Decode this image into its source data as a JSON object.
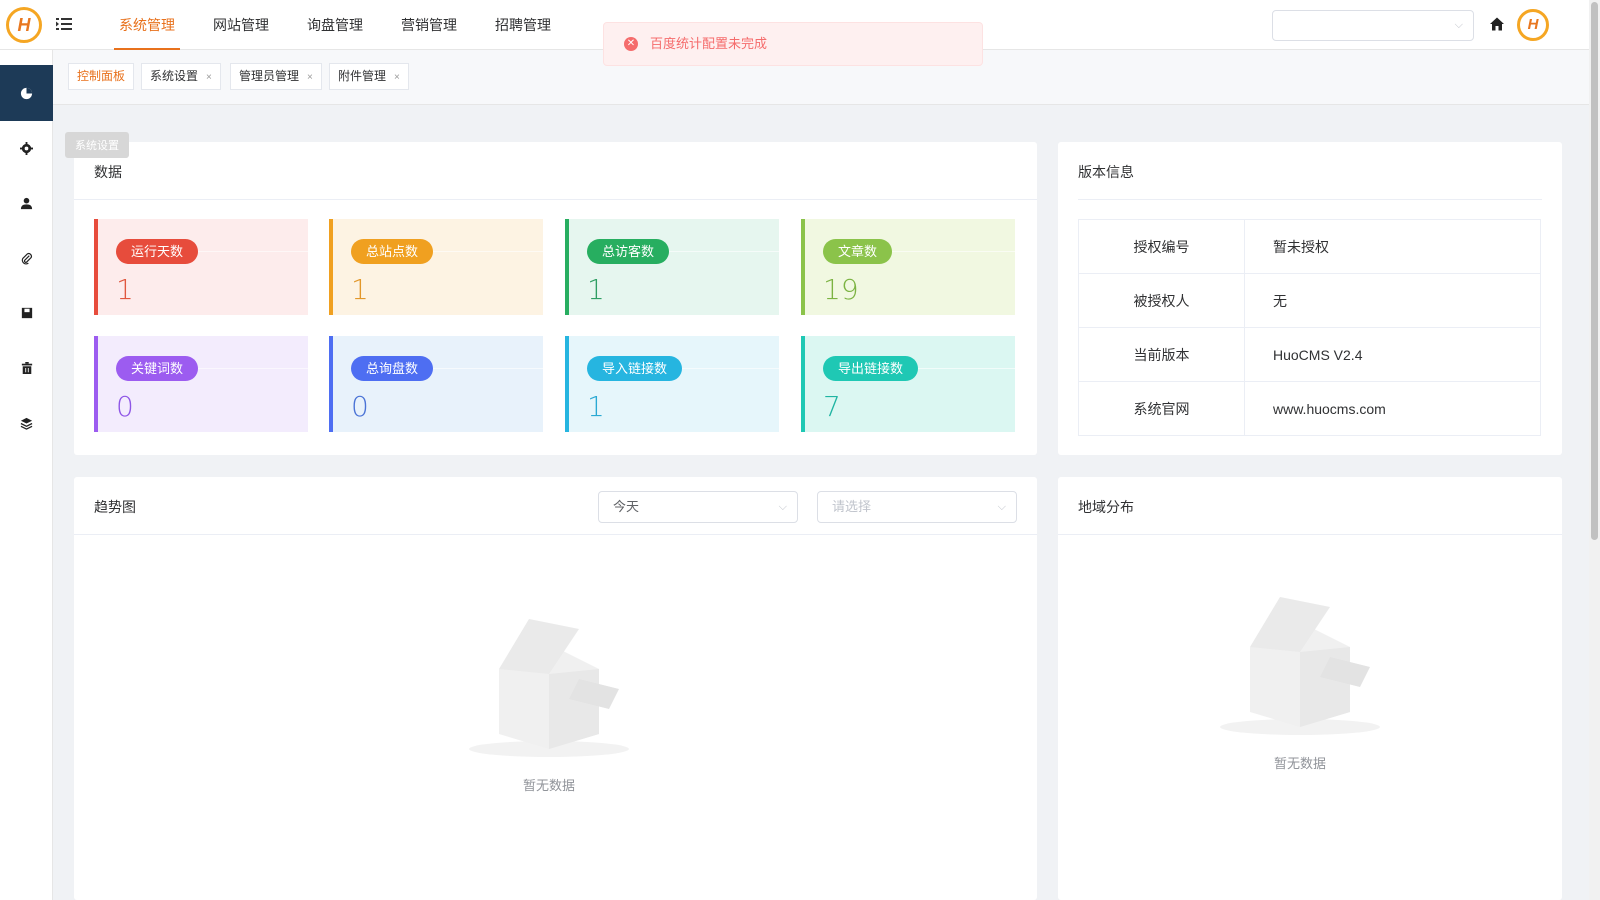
{
  "header": {
    "logo_letter": "H",
    "nav": [
      {
        "label": "系统管理",
        "active": true
      },
      {
        "label": "网站管理",
        "active": false
      },
      {
        "label": "询盘管理",
        "active": false
      },
      {
        "label": "营销管理",
        "active": false
      },
      {
        "label": "招聘管理",
        "active": false
      }
    ],
    "toast": "百度统计配置未完成",
    "site_select_value": "",
    "avatar_letter": "H"
  },
  "sidebar": {
    "icons": [
      "dashboard-icon",
      "gear-icon",
      "user-icon",
      "paperclip-icon",
      "save-icon",
      "trash-icon",
      "layers-icon"
    ],
    "tooltip": "系统设置"
  },
  "tags": [
    {
      "label": "控制面板",
      "closable": false,
      "active": true
    },
    {
      "label": "系统设置",
      "closable": true,
      "active": false
    },
    {
      "label": "管理员管理",
      "closable": true,
      "active": false
    },
    {
      "label": "附件管理",
      "closable": true,
      "active": false
    }
  ],
  "data_panel": {
    "title": "数据",
    "stats": [
      {
        "label": "运行天数",
        "value": "1",
        "color": "#e74c3c",
        "bg": "#fdecec",
        "num_color": "#e0573f"
      },
      {
        "label": "总站点数",
        "value": "1",
        "color": "#f0a020",
        "bg": "#fdf3e3",
        "num_color": "#e2972a"
      },
      {
        "label": "总访客数",
        "value": "1",
        "color": "#27ae60",
        "bg": "#e6f6ef",
        "num_color": "#2f9e63"
      },
      {
        "label": "文章数",
        "value": "19",
        "color": "#8bc34a",
        "bg": "#f1f8e1",
        "num_color": "#7cb342"
      },
      {
        "label": "关键词数",
        "value": "0",
        "color": "#9c5cf0",
        "bg": "#f3ecfd",
        "num_color": "#8e55e6"
      },
      {
        "label": "总询盘数",
        "value": "0",
        "color": "#4e6ef2",
        "bg": "#e8f2fb",
        "num_color": "#4a73d6"
      },
      {
        "label": "导入链接数",
        "value": "1",
        "color": "#26b5e0",
        "bg": "#e6f6fb",
        "num_color": "#2aa9d3"
      },
      {
        "label": "导出链接数",
        "value": "7",
        "color": "#1fc8b4",
        "bg": "#dbf7f2",
        "num_color": "#1fb4a2"
      }
    ]
  },
  "version_panel": {
    "title": "版本信息",
    "rows": [
      {
        "key": "授权编号",
        "value": "暂未授权"
      },
      {
        "key": "被授权人",
        "value": "无"
      },
      {
        "key": "当前版本",
        "value": "HuoCMS V2.4"
      },
      {
        "key": "系统官网",
        "value": "www.huocms.com"
      }
    ]
  },
  "trend_panel": {
    "title": "趋势图",
    "period_value": "今天",
    "site_placeholder": "请选择",
    "empty_text": "暂无数据"
  },
  "region_panel": {
    "title": "地域分布",
    "empty_text": "暂无数据"
  }
}
